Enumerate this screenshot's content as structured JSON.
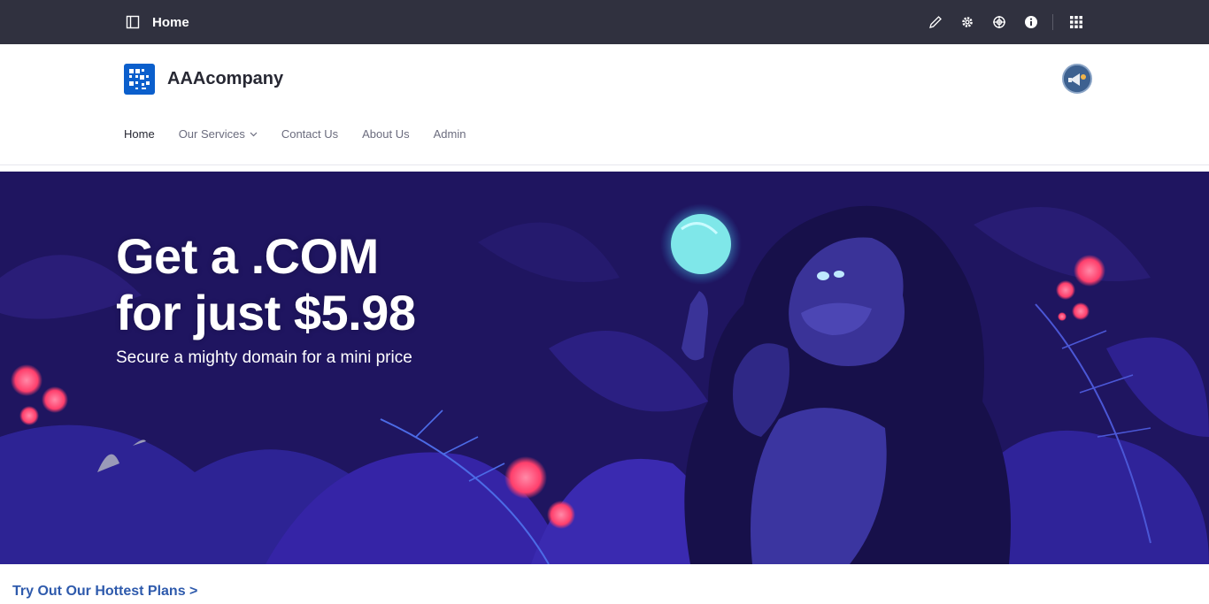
{
  "control_bar": {
    "title": "Home",
    "icons": [
      "sidebar-toggle-icon",
      "pencil-icon",
      "gear-icon",
      "simulation-icon",
      "info-icon",
      "apps-grid-icon"
    ]
  },
  "header": {
    "site_name": "AAAcompany",
    "nav": [
      {
        "label": "Home",
        "active": true
      },
      {
        "label": "Our Services",
        "dropdown": true
      },
      {
        "label": "Contact Us"
      },
      {
        "label": "About Us"
      },
      {
        "label": "Admin"
      }
    ]
  },
  "banner": {
    "headline_line1": "Get a .COM",
    "headline_line2": "for just $5.98",
    "subline": "Secure a mighty domain for a mini price",
    "colors": {
      "background": "#1f1560",
      "accent_orb": "#7fe7e9",
      "flower": "#ff4d7a"
    }
  },
  "plans_link": "Try Out Our Hottest Plans >",
  "colors": {
    "control_bar": "#30313f",
    "logo": "#0b5fcc",
    "link": "#2e5aac"
  }
}
